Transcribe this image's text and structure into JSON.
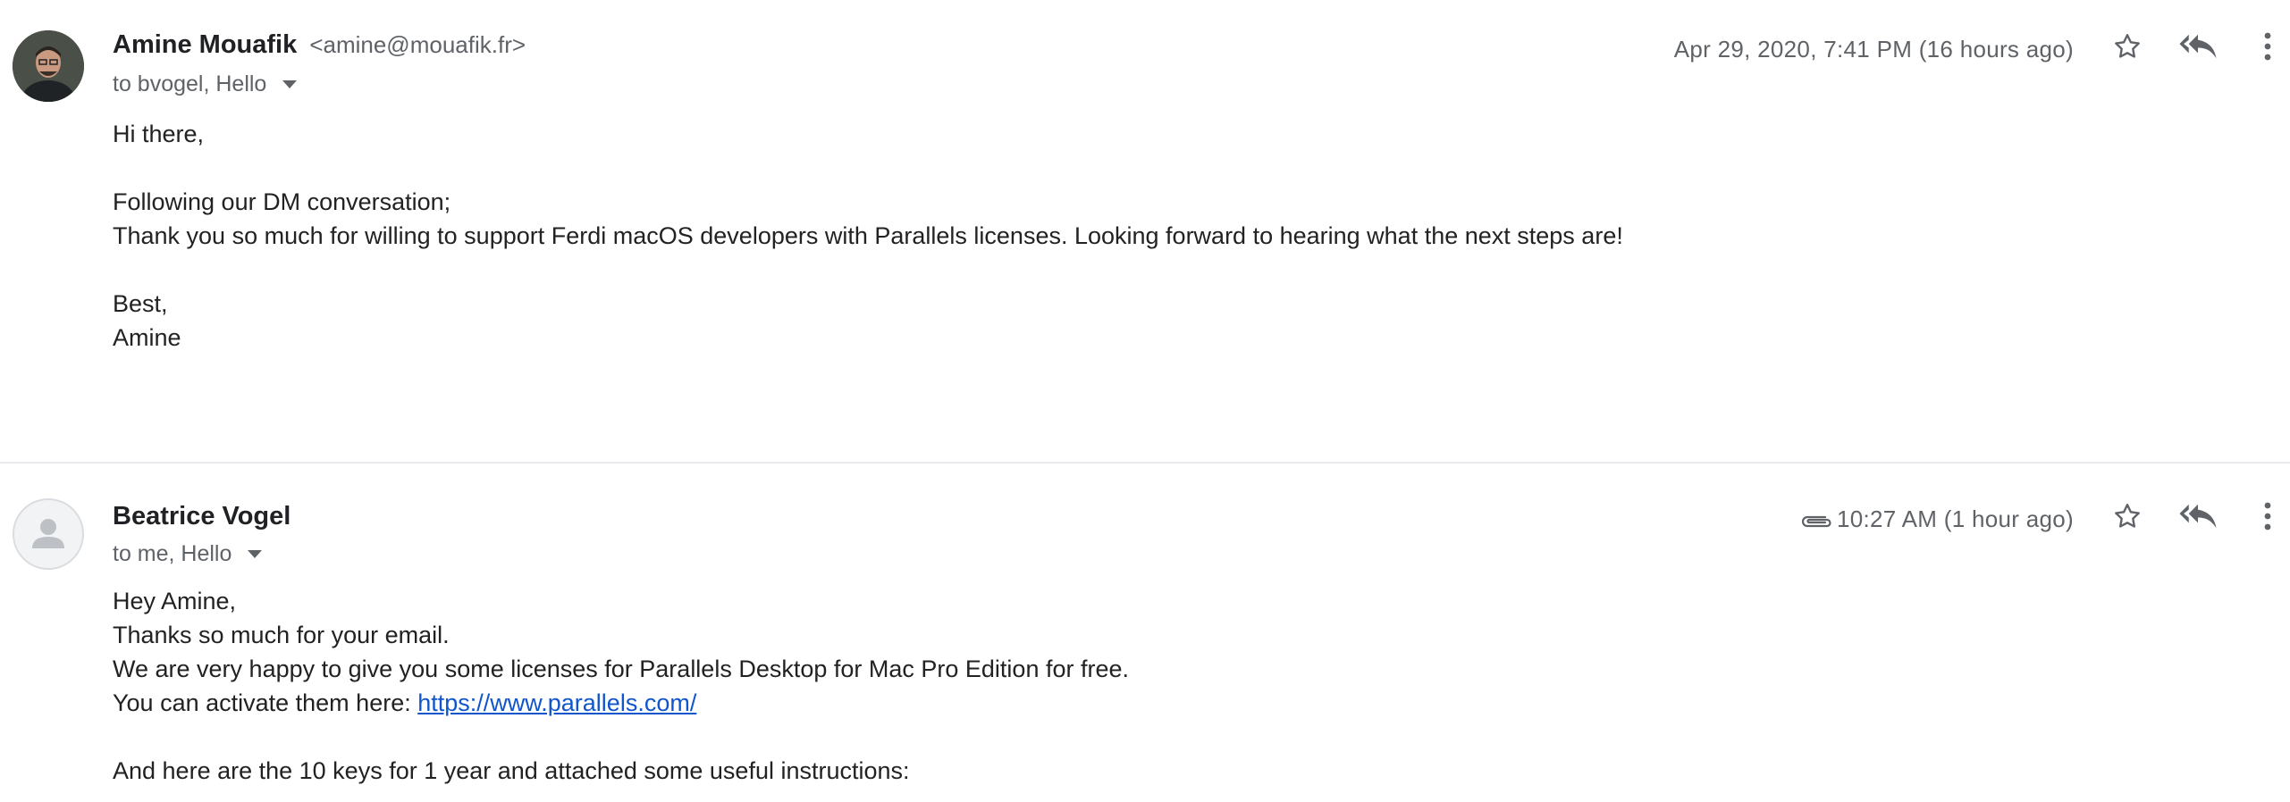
{
  "messages": [
    {
      "sender_name": "Amine Mouafik",
      "sender_email": "<amine@mouafik.fr>",
      "recipients": "to bvogel, Hello",
      "date": "Apr 29, 2020, 7:41 PM (16 hours ago)",
      "has_attachment": false,
      "body": [
        "Hi there,",
        "",
        "Following our DM conversation;",
        "Thank you so much for willing to support Ferdi macOS developers with Parallels licenses. Looking forward to hearing what the next steps are!",
        "",
        "Best,",
        "Amine"
      ]
    },
    {
      "sender_name": "Beatrice Vogel",
      "recipients": "to me, Hello",
      "date": "10:27 AM (1 hour ago)",
      "has_attachment": true,
      "body": [
        "Hey Amine,",
        "Thanks so much for your email.",
        "We are very happy to give you some licenses for Parallels Desktop for Mac Pro Edition for free.",
        "You can activate them here: ",
        "https://www.parallels.com/",
        "",
        "And here are the 10 keys for 1 year and attached some useful instructions:"
      ]
    }
  ],
  "icons": {
    "star": "star-icon",
    "reply": "reply-all-icon",
    "more": "more-vert-icon",
    "attachment": "paperclip-icon"
  },
  "colors": {
    "link": "#1155cc",
    "meta_text": "#5f6368",
    "divider": "#e8eaed"
  }
}
